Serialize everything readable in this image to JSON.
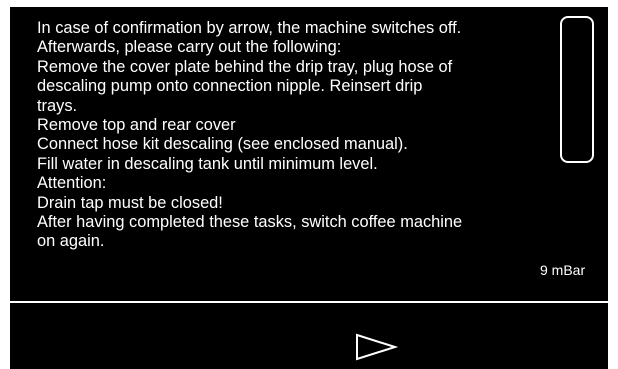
{
  "instructions": [
    "In case of confirmation by arrow, the machine switches off.",
    "Afterwards, please carry out the following:",
    "Remove the cover plate behind the drip tray, plug hose of",
    "descaling pump onto connection nipple. Reinsert drip",
    "trays.",
    "Remove top and rear cover",
    "Connect hose kit descaling (see enclosed manual).",
    "Fill water in descaling tank until minimum level.",
    "Attention:",
    "Drain tap must be closed!",
    "After having completed these tasks, switch coffee machine",
    "on again."
  ],
  "status": {
    "pressure": "9 mBar"
  },
  "controls": {
    "confirm_icon": "right-arrow-outline-icon"
  },
  "colors": {
    "background": "#000000",
    "foreground": "#ffffff"
  }
}
